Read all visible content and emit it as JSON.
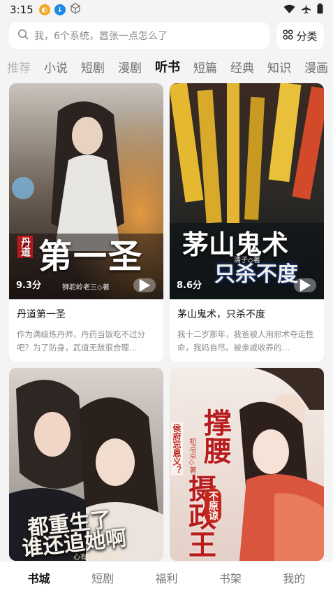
{
  "status": {
    "time": "3:15"
  },
  "search": {
    "placeholder": "我，6个系统，嚣张一点怎么了",
    "category_label": "分类"
  },
  "tabs": [
    {
      "label": "推荐"
    },
    {
      "label": "小说"
    },
    {
      "label": "短剧"
    },
    {
      "label": "漫剧"
    },
    {
      "label": "听书"
    },
    {
      "label": "短篇"
    },
    {
      "label": "经典"
    },
    {
      "label": "知识"
    },
    {
      "label": "漫画"
    }
  ],
  "books": [
    {
      "cover_title_small": "丹道",
      "cover_title": "第一圣",
      "cover_author": "狮驼岭老三◇著",
      "score": "9.3分",
      "title": "丹道第一圣",
      "desc": "作为满级炼丹师，丹药当饭吃不过分吧？为了防身，武道无敌很合理…"
    },
    {
      "cover_title": "茅山鬼术",
      "cover_subtitle": "只杀不度",
      "cover_author": "清子◇著",
      "score": "8.6分",
      "title": "茅山鬼术，只杀不度",
      "desc": "我十二岁那年，我爸被人用邪术夺走性命，我妈自尽。被亲戚收养的…"
    },
    {
      "cover_title": "都重生了",
      "cover_subtitle": "谁还追她啊",
      "cover_author": "心有浩然气◇著"
    },
    {
      "cover_title": "撑腰",
      "cover_subtitle": "摄政王",
      "cover_side": "侯府忘恩义？",
      "cover_seal": "不原谅",
      "cover_author": "初点点◇著"
    }
  ],
  "nav": [
    {
      "label": "书城"
    },
    {
      "label": "短剧"
    },
    {
      "label": "福利"
    },
    {
      "label": "书架"
    },
    {
      "label": "我的"
    }
  ]
}
